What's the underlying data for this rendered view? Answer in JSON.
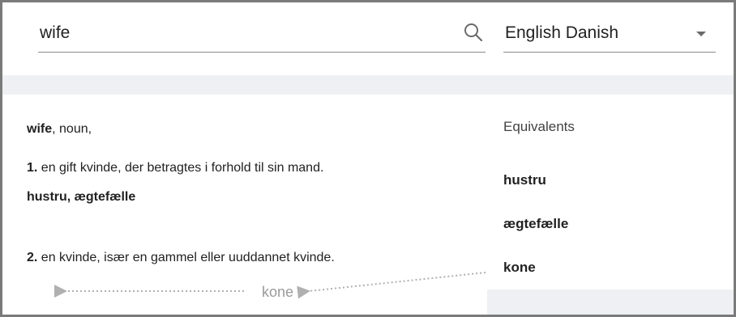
{
  "search": {
    "value": "wife",
    "icon": "search-icon"
  },
  "language": {
    "selected": "English Danish",
    "icon": "chevron-down-icon"
  },
  "entry": {
    "headword": "wife",
    "pos": ", noun,",
    "senses": [
      {
        "number": "1.",
        "definition": " en gift kvinde, der betragtes i forhold til sin mand.",
        "translations": "hustru, ægtefælle"
      },
      {
        "number": "2.",
        "definition": " en kvinde, især en gammel eller uuddannet kvinde.",
        "translations": "kone"
      }
    ]
  },
  "equivalents": {
    "title": "Equivalents",
    "items": [
      "hustru",
      "ægtefælle",
      "kone"
    ]
  },
  "colors": {
    "band": "#eef0f3",
    "border": "#7a7a7a",
    "muted_text": "#9a9a9a"
  }
}
